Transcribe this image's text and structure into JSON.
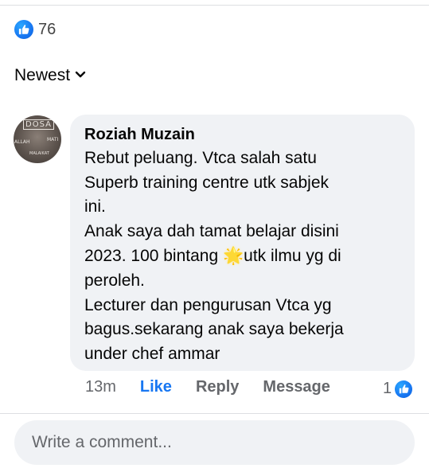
{
  "reactions": {
    "count": "76",
    "icon": "thumbs-up-icon"
  },
  "sort": {
    "label": "Newest",
    "icon": "chevron-down-icon"
  },
  "comment": {
    "author": "Roziah Muzain",
    "avatar_text": {
      "main": "DOSA",
      "left": "ALLAH",
      "right": "MATI",
      "bottom": "MALAIKAT"
    },
    "text_part1": "Rebut peluang. Vtca salah satu\nSuperb training centre utk sabjek\nini.\nAnak saya dah tamat belajar disini\n2023. 100 bintang ",
    "emoji": "🌟",
    "text_part2": "utk ilmu yg di\nperoleh.\nLecturer dan pengurusan Vtca yg\nbagus.sekarang anak saya bekerja\nunder chef ammar",
    "time": "13m",
    "actions": {
      "like": "Like",
      "reply": "Reply",
      "message": "Message"
    },
    "reaction_count": "1"
  },
  "composer": {
    "placeholder": "Write a comment..."
  },
  "colors": {
    "accent": "#1877f2",
    "bubble": "#f0f2f5",
    "muted": "#65676b"
  }
}
